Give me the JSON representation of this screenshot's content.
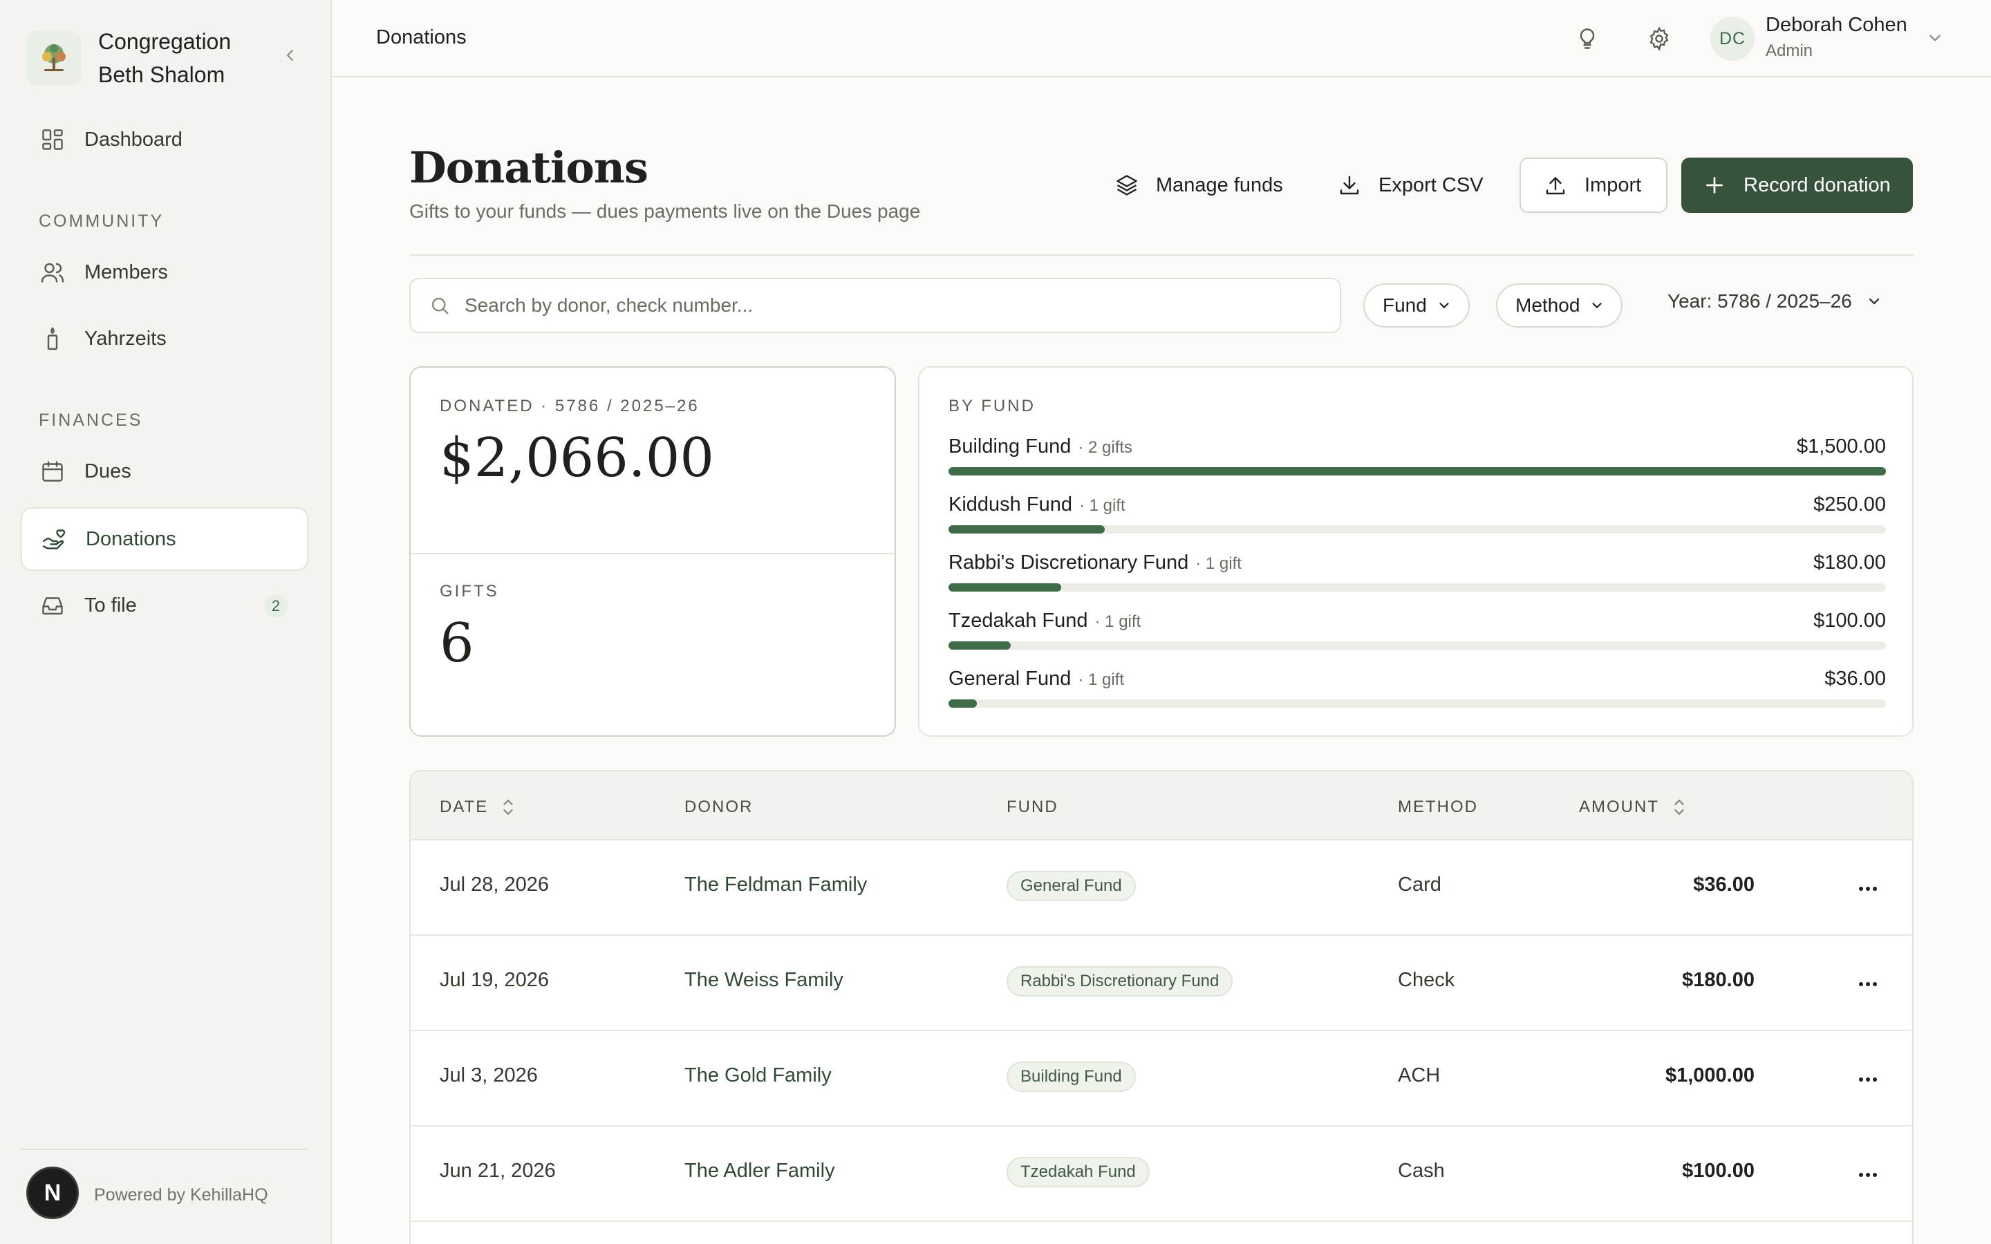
{
  "org": {
    "name": "Congregation Beth Shalom"
  },
  "sidebar": {
    "dashboard": "Dashboard",
    "community_heading": "COMMUNITY",
    "members": "Members",
    "yahrzeits": "Yahrzeits",
    "finances_heading": "FINANCES",
    "dues": "Dues",
    "donations": "Donations",
    "to_file": "To file",
    "to_file_count": "2",
    "powered": "Powered by KehillaHQ",
    "avatar_letter": "N"
  },
  "topbar": {
    "breadcrumb": "Donations",
    "user_initials": "DC",
    "user_name": "Deborah Cohen",
    "user_role": "Admin"
  },
  "page": {
    "title": "Donations",
    "subtitle": "Gifts to your funds — dues payments live on the Dues page",
    "manage_funds": "Manage funds",
    "export_csv": "Export CSV",
    "import": "Import",
    "record_donation": "Record donation"
  },
  "filters": {
    "search_placeholder": "Search by donor, check number...",
    "fund": "Fund",
    "method": "Method",
    "year": "Year: 5786 / 2025–26"
  },
  "stats": {
    "donated_label": "DONATED · 5786 / 2025–26",
    "donated_value": "$2,066.00",
    "gifts_label": "GIFTS",
    "gifts_value": "6"
  },
  "by_fund": {
    "title": "BY FUND",
    "funds": [
      {
        "name": "Building Fund",
        "count": "· 2 gifts",
        "amount": "$1,500.00",
        "value": 1500
      },
      {
        "name": "Kiddush Fund",
        "count": "· 1 gift",
        "amount": "$250.00",
        "value": 250
      },
      {
        "name": "Rabbi's Discretionary Fund",
        "count": "· 1 gift",
        "amount": "$180.00",
        "value": 180
      },
      {
        "name": "Tzedakah Fund",
        "count": "· 1 gift",
        "amount": "$100.00",
        "value": 100
      },
      {
        "name": "General Fund",
        "count": "· 1 gift",
        "amount": "$36.00",
        "value": 36
      }
    ]
  },
  "table": {
    "headers": {
      "date": "DATE",
      "donor": "DONOR",
      "fund": "FUND",
      "method": "METHOD",
      "amount": "AMOUNT"
    },
    "rows": [
      {
        "date": "Jul 28, 2026",
        "donor": "The Feldman Family",
        "fund": "General Fund",
        "method": "Card",
        "amount": "$36.00"
      },
      {
        "date": "Jul 19, 2026",
        "donor": "The Weiss Family",
        "fund": "Rabbi's Discretionary Fund",
        "method": "Check",
        "amount": "$180.00"
      },
      {
        "date": "Jul 3, 2026",
        "donor": "The Gold Family",
        "fund": "Building Fund",
        "method": "ACH",
        "amount": "$1,000.00"
      },
      {
        "date": "Jun 21, 2026",
        "donor": "The Adler Family",
        "fund": "Tzedakah Fund",
        "method": "Cash",
        "amount": "$100.00"
      }
    ]
  },
  "colors": {
    "brand": "#37533b",
    "accent_bar": "#3f6b48",
    "background": "#fbfaf8",
    "sidebar": "#f4f3ef"
  }
}
